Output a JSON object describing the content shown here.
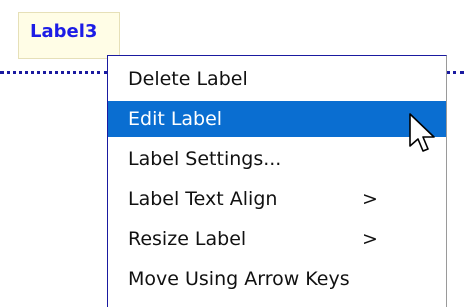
{
  "label": {
    "text": "Label3"
  },
  "context_menu": {
    "items": [
      {
        "label": "Delete Label",
        "has_submenu": false,
        "submenu_indicator": ""
      },
      {
        "label": "Edit Label",
        "has_submenu": false,
        "submenu_indicator": "",
        "highlighted": true
      },
      {
        "label": "Label Settings...",
        "has_submenu": false,
        "submenu_indicator": ""
      },
      {
        "label": "Label Text Align",
        "has_submenu": true,
        "submenu_indicator": ">"
      },
      {
        "label": "Resize Label",
        "has_submenu": true,
        "submenu_indicator": ">"
      },
      {
        "label": "Move Using Arrow Keys",
        "has_submenu": false,
        "submenu_indicator": ""
      }
    ]
  },
  "colors": {
    "label_text": "#1c1ce6",
    "label_background": "#fffde6",
    "highlight": "#0a6ed1",
    "dotted_line": "#1a1aa0"
  },
  "icons": {
    "cursor": "mouse-pointer-icon"
  }
}
